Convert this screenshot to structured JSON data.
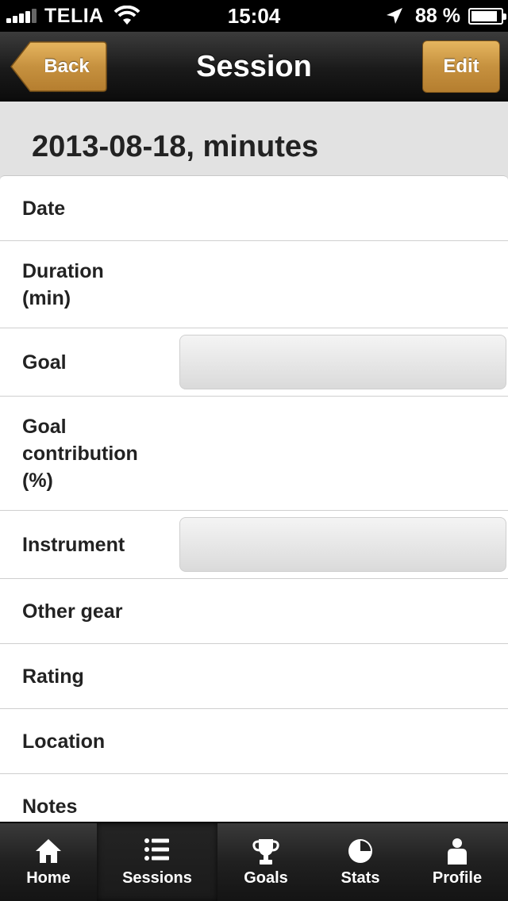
{
  "status_bar": {
    "carrier": "TELIA",
    "time": "15:04",
    "battery": "88 %",
    "battery_level": 0.88
  },
  "nav": {
    "title": "Session",
    "back_label": "Back",
    "edit_label": "Edit",
    "accent_color": "#c99a4a"
  },
  "page": {
    "title": "2013-08-18, minutes"
  },
  "form": {
    "rows": [
      {
        "label": "Date"
      },
      {
        "label": "Duration\n(min)"
      },
      {
        "label": "Goal"
      },
      {
        "label": "Goal\ncontribution\n(%)"
      },
      {
        "label": "Instrument"
      },
      {
        "label": "Other gear"
      },
      {
        "label": "Rating"
      },
      {
        "label": "Location"
      },
      {
        "label": "Notes"
      }
    ]
  },
  "tabs": [
    {
      "label": "Home",
      "icon": "home-icon",
      "active": false
    },
    {
      "label": "Sessions",
      "icon": "list-icon",
      "active": true
    },
    {
      "label": "Goals",
      "icon": "trophy-icon",
      "active": false
    },
    {
      "label": "Stats",
      "icon": "pie-chart-icon",
      "active": false
    },
    {
      "label": "Profile",
      "icon": "person-icon",
      "active": false
    }
  ]
}
